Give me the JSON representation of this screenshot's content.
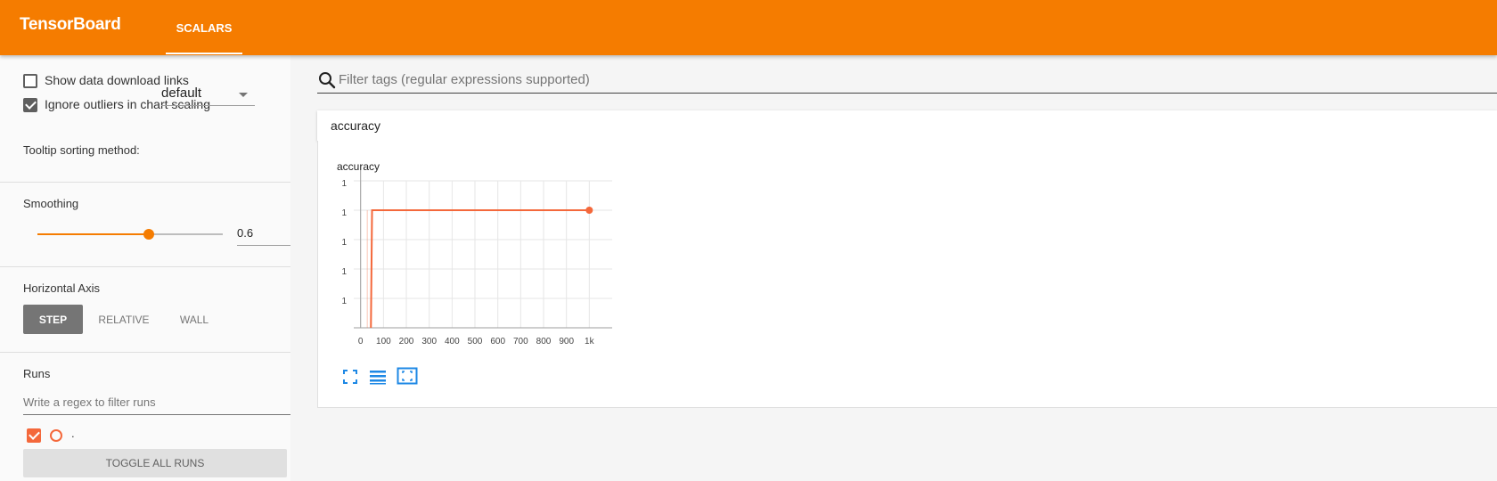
{
  "app": {
    "brand": "TensorBoard",
    "active_tab": "SCALARS",
    "colors": {
      "primary": "#f57c00",
      "run_color": "#f4683b"
    }
  },
  "sidebar": {
    "show_download_links": {
      "label": "Show data download links",
      "checked": false
    },
    "ignore_outliers": {
      "label": "Ignore outliers in chart scaling",
      "checked": true
    },
    "tooltip_sorting": {
      "label": "Tooltip sorting method:",
      "value": "default"
    },
    "smoothing": {
      "title": "Smoothing",
      "value": "0.6",
      "fraction": 0.6
    },
    "horizontal_axis": {
      "title": "Horizontal Axis",
      "options": [
        "STEP",
        "RELATIVE",
        "WALL"
      ],
      "selected": "STEP"
    },
    "runs": {
      "title": "Runs",
      "filter_placeholder": "Write a regex to filter runs",
      "items": [
        {
          "name": ".",
          "checked": true
        }
      ],
      "toggle_all_label": "TOGGLE ALL RUNS"
    }
  },
  "main": {
    "tag_filter_placeholder": "Filter tags (regular expressions supported)",
    "category": "accuracy",
    "card_icons": [
      "fullscreen-icon",
      "toggle-log-scale-icon",
      "fit-domain-icon"
    ]
  },
  "chart_data": {
    "type": "line",
    "title": "accuracy",
    "xlabel": "",
    "ylabel": "",
    "x_ticks": [
      "0",
      "100",
      "200",
      "300",
      "400",
      "500",
      "600",
      "700",
      "800",
      "900",
      "1k"
    ],
    "y_ticks": [
      "1",
      "1",
      "1",
      "1",
      "1"
    ],
    "xlim": [
      -30,
      1100
    ],
    "ylim": [
      0,
      1
    ],
    "grid": true,
    "series": [
      {
        "color": "#f4683b",
        "points": [
          [
            45,
            0
          ],
          [
            50,
            0.8
          ],
          [
            55,
            0.8
          ],
          [
            1000,
            0.8
          ]
        ],
        "final_point": [
          1000,
          0.8
        ]
      }
    ]
  }
}
